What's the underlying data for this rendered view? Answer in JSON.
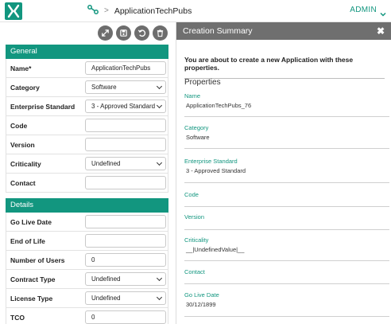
{
  "header": {
    "breadcrumb_title": "ApplicationTechPubs",
    "breadcrumb_separator": ">",
    "user_menu": "ADMIN",
    "brand_color": "#12967f"
  },
  "toolbar": {
    "icons": [
      "expand-icon",
      "save-icon",
      "undo-icon",
      "delete-icon"
    ]
  },
  "general": {
    "title": "General",
    "fields": [
      {
        "label": "Name*",
        "value": "ApplicationTechPubs",
        "type": "text"
      },
      {
        "label": "Category",
        "value": "Software",
        "type": "select"
      },
      {
        "label": "Enterprise Standard",
        "value": "3 - Approved Standard",
        "type": "select"
      },
      {
        "label": "Code",
        "value": "",
        "type": "text"
      },
      {
        "label": "Version",
        "value": "",
        "type": "text"
      },
      {
        "label": "Criticality",
        "value": "Undefined",
        "type": "select"
      },
      {
        "label": "Contact",
        "value": "",
        "type": "text"
      }
    ]
  },
  "details": {
    "title": "Details",
    "fields": [
      {
        "label": "Go Live Date",
        "value": "",
        "type": "text"
      },
      {
        "label": "End of Life",
        "value": "",
        "type": "text"
      },
      {
        "label": "Number of Users",
        "value": "0",
        "type": "text"
      },
      {
        "label": "Contract Type",
        "value": "Undefined",
        "type": "select"
      },
      {
        "label": "License Type",
        "value": "Undefined",
        "type": "select"
      },
      {
        "label": "TCO",
        "value": "0",
        "type": "text"
      }
    ]
  },
  "summary": {
    "title": "Creation Summary",
    "close": "✖",
    "intro": "You are about to create a new Application with these properties.",
    "properties_title": "Properties",
    "properties": [
      {
        "name": "Name",
        "value": "ApplicationTechPubs_76"
      },
      {
        "name": "Category",
        "value": "Software"
      },
      {
        "name": "Enterprise Standard",
        "value": "3 - Approved Standard"
      },
      {
        "name": "Code",
        "value": ""
      },
      {
        "name": "Version",
        "value": ""
      },
      {
        "name": "Criticality",
        "value": "__|UndefinedValue|__"
      },
      {
        "name": "Contact",
        "value": ""
      },
      {
        "name": "Go Live Date",
        "value": "30/12/1899"
      }
    ]
  }
}
